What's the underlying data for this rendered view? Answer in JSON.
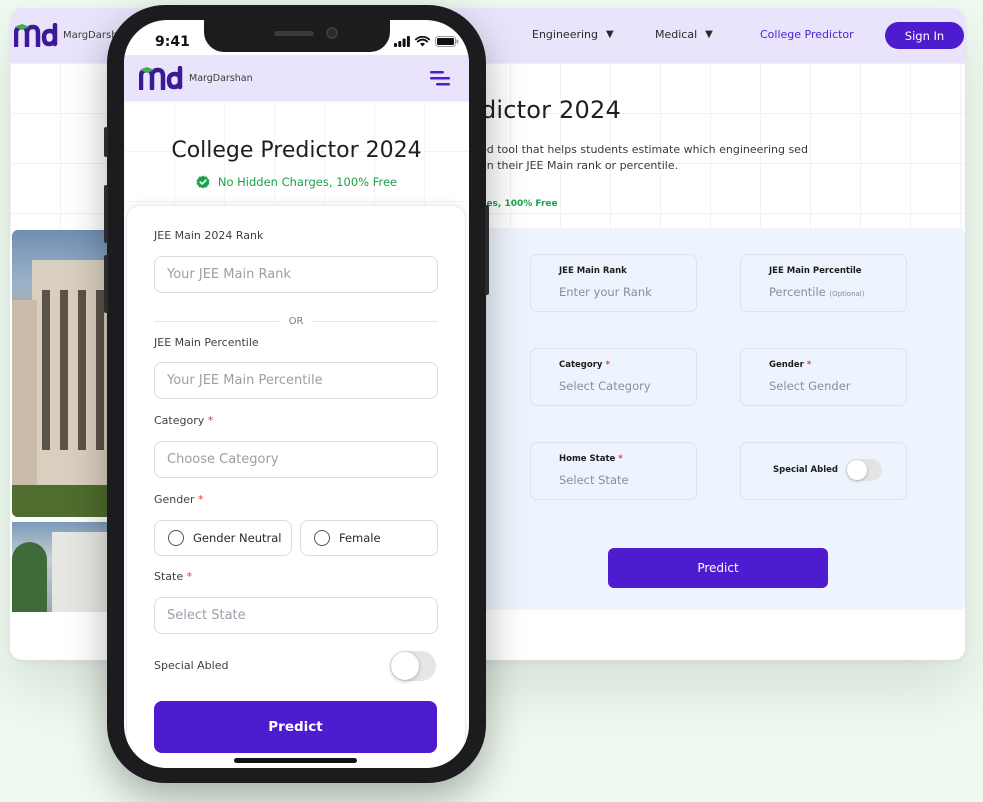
{
  "desktop": {
    "brand": "MargDarshan",
    "nav": {
      "engineering": "Engineering",
      "medical": "Medical",
      "college_predictor": "College Predictor",
      "sign_in": "Sign In",
      "caret": "▼"
    },
    "hero": {
      "title": "edictor 2024",
      "description": "ed tool that helps students estimate which engineering sed on their JEE Main rank or percentile.",
      "no_hidden": "ges, 100% Free"
    },
    "form": {
      "rank": {
        "label": "JEE Main Rank",
        "placeholder": "Enter your Rank"
      },
      "percentile": {
        "label": "JEE Main Percentile",
        "placeholder": "Percentile",
        "optional": "(Optional)"
      },
      "category": {
        "label": "Category",
        "placeholder": "Select Category"
      },
      "gender": {
        "label": "Gender",
        "placeholder": "Select Gender"
      },
      "home_state": {
        "label": "Home State",
        "placeholder": "Select State"
      },
      "special_abled": {
        "label": "Special Abled",
        "on": false
      },
      "required_mark": "*",
      "predict": "Predict"
    }
  },
  "phone": {
    "status_time": "9:41",
    "brand": "MargDarshan",
    "title": "College Predictor 2024",
    "no_hidden": "No Hidden Charges, 100% Free",
    "form": {
      "rank_label": "JEE Main 2024 Rank",
      "rank_placeholder": "Your JEE Main Rank",
      "or": "OR",
      "percentile_label": "JEE Main Percentile",
      "percentile_placeholder": "Your JEE Main Percentile",
      "category_label": "Category",
      "category_placeholder": "Choose Category",
      "gender_label": "Gender",
      "gender_options": [
        "Gender Neutral",
        "Female"
      ],
      "state_label": "State",
      "state_placeholder": "Select State",
      "special_abled_label": "Special Abled",
      "special_abled_on": false,
      "required_mark": "*",
      "predict": "Predict"
    }
  },
  "colors": {
    "brand_purple": "#4d1ccf",
    "nav_lavender": "#e9e4fb",
    "success_green": "#1aa34a",
    "logo_green": "#3fae49",
    "logo_purple": "#3c1a96"
  },
  "icons": [
    "logo-icon",
    "caret-down-icon",
    "check-badge-icon",
    "hamburger-menu-icon",
    "signal-icon",
    "wifi-icon",
    "battery-icon"
  ]
}
